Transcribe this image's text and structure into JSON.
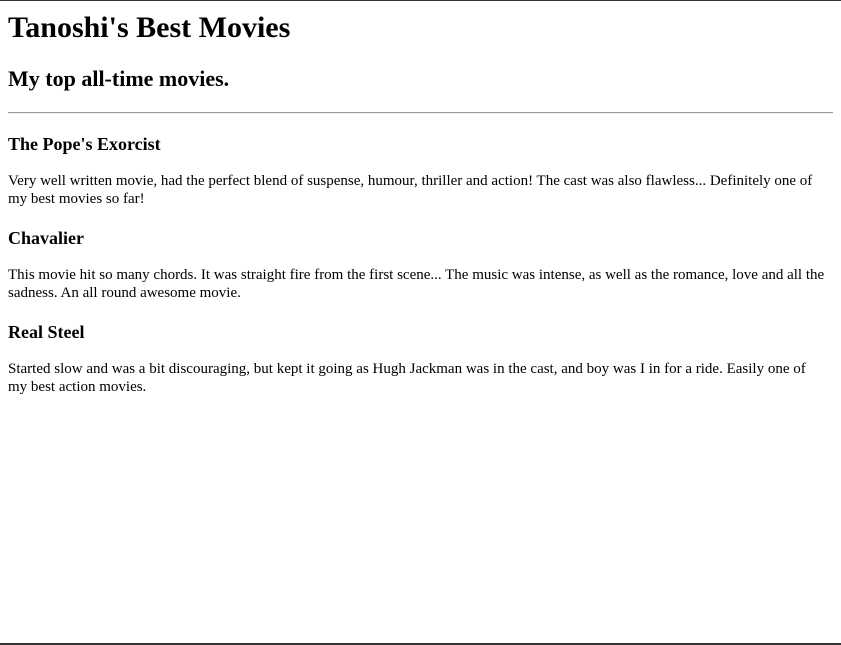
{
  "header": {
    "title": "Tanoshi's Best Movies",
    "subtitle": "My top all-time movies."
  },
  "movies": [
    {
      "title": "The Pope's Exorcist",
      "review": "Very well written movie, had the perfect blend of suspense, humour, thriller and action! The cast was also flawless... Definitely one of my best movies so far!"
    },
    {
      "title": "Chavalier",
      "review": "This movie hit so many chords. It was straight fire from the first scene... The music was intense, as well as the romance, love and all the sadness. An all round awesome movie."
    },
    {
      "title": "Real Steel",
      "review": "Started slow and was a bit discouraging, but kept it going as Hugh Jackman was in the cast, and boy was I in for a ride. Easily one of my best action movies."
    }
  ]
}
